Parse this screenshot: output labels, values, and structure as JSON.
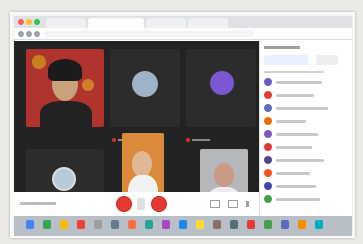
{
  "scene": "photo-of-monitor-showing-video-call",
  "colors": {
    "stage_bg": "#232323",
    "tile_bg": "#3c4043",
    "accent_red": "#e53935",
    "panel_bg": "#ffffff"
  },
  "tiles": [
    {
      "name": "participant-woman-red-background",
      "type": "video"
    },
    {
      "name": "participant-avatar-1",
      "type": "avatar",
      "color": "#9fb3c8"
    },
    {
      "name": "participant-avatar-2",
      "type": "avatar",
      "color": "#7b57d1"
    },
    {
      "name": "participant-avatar-3",
      "type": "avatar",
      "color": "#b8c9d9"
    },
    {
      "name": "participant-woman-orange",
      "type": "video"
    },
    {
      "name": "participant-person-white",
      "type": "video"
    }
  ],
  "participants": [
    {
      "color": "#6a5acd"
    },
    {
      "color": "#e53935"
    },
    {
      "color": "#5c6bc0"
    },
    {
      "color": "#ef6c00"
    },
    {
      "color": "#7e57c2"
    },
    {
      "color": "#e53935"
    },
    {
      "color": "#4a4a8a"
    },
    {
      "color": "#f4511e"
    },
    {
      "color": "#3949ab"
    },
    {
      "color": "#43a047"
    }
  ],
  "dock_icons": [
    "#4285f4",
    "#34a853",
    "#fbbc05",
    "#ea4335",
    "#9e9e9e",
    "#607d8b",
    "#ff7043",
    "#26a69a",
    "#ab47bc",
    "#1e88e5",
    "#fdd835",
    "#8d6e63",
    "#546e7a",
    "#e53935",
    "#43a047",
    "#5c6bc0",
    "#fb8c00",
    "#00acc1"
  ]
}
